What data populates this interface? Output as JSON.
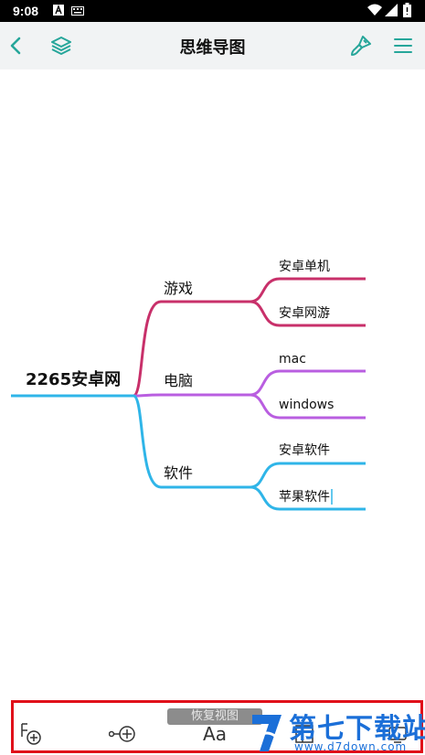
{
  "status_bar": {
    "time": "9:08",
    "icons": [
      "text-a-icon",
      "keyboard-icon",
      "wifi-icon",
      "signal-icon",
      "battery-icon"
    ]
  },
  "app_bar": {
    "title": "思维导图",
    "left_icons": [
      "back-icon",
      "layers-icon"
    ],
    "right_icons": [
      "brush-icon",
      "menu-icon"
    ],
    "accent": "#26a69a"
  },
  "mindmap": {
    "root": "2265安卓网",
    "branches": [
      {
        "label": "游戏",
        "color": "#c8306a",
        "children": [
          "安卓单机",
          "安卓网游"
        ]
      },
      {
        "label": "电脑",
        "color": "#b95ee0",
        "children": [
          "mac",
          "windows"
        ]
      },
      {
        "label": "软件",
        "color": "#2fb5e8",
        "children": [
          "安卓软件",
          "苹果软件"
        ]
      }
    ],
    "root_line_color": "#2fb5e8"
  },
  "bottom_toolbar": {
    "toast": "恢复视图",
    "tools": [
      {
        "name": "add-child-node",
        "icon": "add-node-icon"
      },
      {
        "name": "add-sibling-node",
        "icon": "add-link-node-icon"
      },
      {
        "name": "text-style",
        "icon": "font-icon",
        "label": "Aa"
      },
      {
        "name": "layout",
        "icon": "layout-icon"
      },
      {
        "name": "more",
        "icon": "more-icon"
      }
    ],
    "highlight_color": "#e0101a"
  },
  "watermark": {
    "title": "第七下载站",
    "url": "www.d7down.com"
  }
}
